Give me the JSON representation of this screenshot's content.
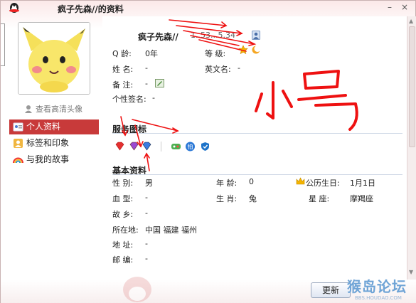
{
  "window": {
    "title": "疯子先森//的资料"
  },
  "left": {
    "hd_link": "查看高清头像",
    "nav": [
      {
        "label": "个人资料"
      },
      {
        "label": "标签和印象"
      },
      {
        "label": "与我的故事"
      }
    ]
  },
  "profile": {
    "name": "疯子先森//",
    "qq_number": "1..53...5.34",
    "qage_label": "Q 龄:",
    "qage_value": "0年",
    "level_label": "等 级:",
    "name_label": "姓 名:",
    "name_value": "-",
    "eng_label": "英文名:",
    "eng_value": "-",
    "note_label": "备 注:",
    "note_value": "-",
    "sign_label": "个性签名:",
    "sign_value": "-"
  },
  "services": {
    "title": "服务图标",
    "icons": [
      "red-diamond-icon",
      "purple-diamond-icon",
      "blue-diamond-icon",
      "game-icon",
      "pai-icon",
      "shield-icon"
    ]
  },
  "basic": {
    "title": "基本资料",
    "gender_label": "性 别:",
    "gender_value": "男",
    "age_label": "年 龄:",
    "age_value": "0",
    "bday_label": "公历生日:",
    "bday_value": "1月1日",
    "blood_label": "血 型:",
    "blood_value": "-",
    "zodiac_label": "生 肖:",
    "zodiac_value": "兔",
    "star_label": "星 座:",
    "star_value": "摩羯座",
    "hometown_label": "故 乡:",
    "hometown_value": "-",
    "location_label": "所在地:",
    "location_value": "中国 福建 福州",
    "address_label": "地 址:",
    "address_value": "-",
    "zip_label": "邮 编:",
    "zip_value": "-"
  },
  "footer": {
    "refresh": "更新"
  },
  "annotation": {
    "handwriting": "小号",
    "color": "#ee1111"
  },
  "watermark": {
    "text": "猴岛论坛",
    "url": "BBS.HOUDAO.COM"
  }
}
